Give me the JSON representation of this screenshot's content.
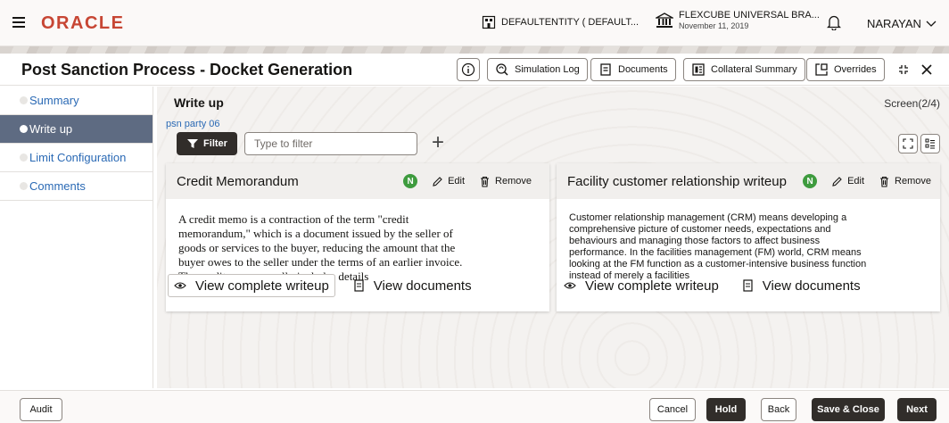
{
  "topbar": {
    "logo": "ORACLE",
    "entity": "DEFAULTENTITY ( DEFAULT...",
    "branch_name": "FLEXCUBE UNIVERSAL BRA...",
    "branch_date": "November 11, 2019",
    "user": "NARAYAN"
  },
  "header": {
    "title": "Post Sanction Process - Docket Generation",
    "simulation_log": "Simulation Log",
    "documents": "Documents",
    "collateral_summary": "Collateral Summary",
    "overrides": "Overrides"
  },
  "sidebar": {
    "items": [
      {
        "label": "Summary",
        "active": false
      },
      {
        "label": "Write up",
        "active": true
      },
      {
        "label": "Limit Configuration",
        "active": false
      },
      {
        "label": "Comments",
        "active": false
      }
    ]
  },
  "main": {
    "section_title": "Write up",
    "screen_counter": "Screen(2/4)",
    "party": "psn party 06",
    "filter_label": "Filter",
    "filter_placeholder": "Type to filter"
  },
  "cards": [
    {
      "title": "Credit Memorandum",
      "badge": "N",
      "edit": "Edit",
      "remove": "Remove",
      "body": "A credit memo is a contraction of the term \"credit memorandum,\" which is a document issued by the seller of goods or services to the buyer, reducing the amount that the buyer owes to the seller under the terms of an earlier invoice. The credit memo usually includes details",
      "view_writeup": "View complete writeup",
      "view_documents": "View documents"
    },
    {
      "title": "Facility customer relationship writeup",
      "badge": "N",
      "edit": "Edit",
      "remove": "Remove",
      "body": "Customer relationship management (CRM) means developing a comprehensive picture of customer needs, expectations and behaviours and managing those factors to affect business performance. In the facilities management (FM) world, CRM means looking at the FM function as a customer-intensive business function instead of merely a facilities",
      "view_writeup": "View complete writeup",
      "view_documents": "View documents"
    }
  ],
  "footer": {
    "audit": "Audit",
    "cancel": "Cancel",
    "hold": "Hold",
    "back": "Back",
    "save_close": "Save & Close",
    "next": "Next"
  },
  "colors": {
    "brand": "#c74634",
    "link": "#2b6ab5",
    "active_nav": "#5e6b82",
    "dark_button": "#312d2a",
    "badge": "#3e9b3e"
  }
}
